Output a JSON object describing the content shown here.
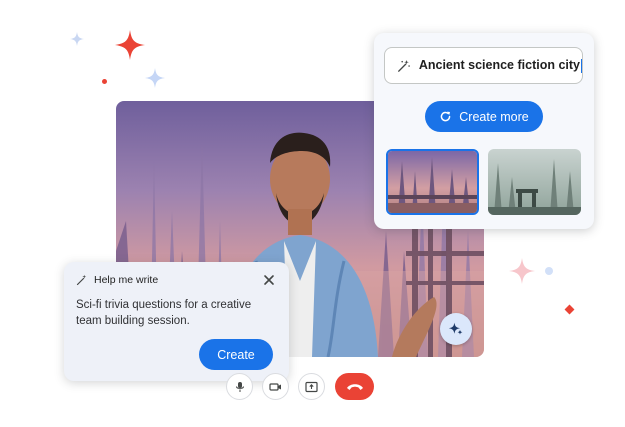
{
  "background_prompt": {
    "value": "Ancient science fiction city",
    "create_more_label": "Create more"
  },
  "help_me_write": {
    "title": "Help me write",
    "body": "Sci-fi trivia questions for a creative team building session.",
    "create_label": "Create"
  },
  "icons": [
    "magic-wand-icon",
    "refresh-icon",
    "close-icon",
    "sparkle-effects-icon",
    "microphone-icon",
    "camera-icon",
    "present-screen-icon",
    "hang-up-icon"
  ],
  "colors": {
    "accent": "#1a73e8",
    "hangup": "#ea4335",
    "sparkle_red": "#ea4335",
    "sparkle_blue": "#c8d8f5",
    "sparkle_pink": "#f8c8cc"
  }
}
